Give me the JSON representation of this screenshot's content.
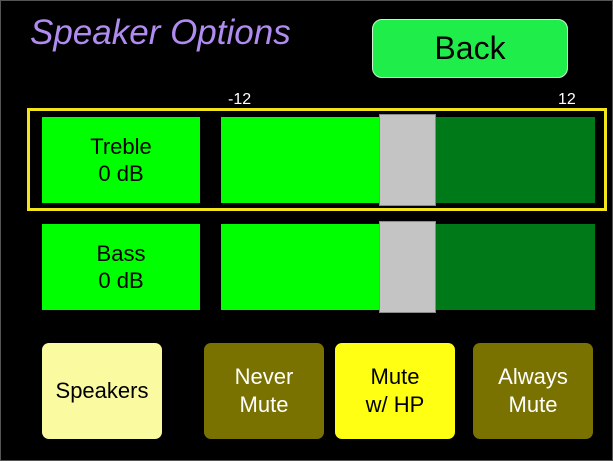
{
  "screen": {
    "title": "Speaker Options",
    "back_label": "Back"
  },
  "scale": {
    "min_label": "-12",
    "max_label": "12",
    "min": -12,
    "max": 12
  },
  "controls": [
    {
      "name": "Treble",
      "value_text": "0 dB",
      "value": 0,
      "selected": true
    },
    {
      "name": "Bass",
      "value_text": "0 dB",
      "value": 0,
      "selected": false
    }
  ],
  "modes": [
    {
      "lines": [
        "Speakers"
      ],
      "color": "#fafaa0",
      "text_color": "#000000"
    },
    {
      "lines": [
        "Never",
        "Mute"
      ],
      "color": "#7a7200",
      "text_color": "#ffffff"
    },
    {
      "lines": [
        "Mute",
        "w/ HP"
      ],
      "color": "#ffff14",
      "text_color": "#000000"
    },
    {
      "lines": [
        "Always",
        "Mute"
      ],
      "color": "#7a7200",
      "text_color": "#ffffff"
    }
  ],
  "colors": {
    "background": "#000000",
    "title": "#b08cf0",
    "back_button": "#1fee4a",
    "selection_outline": "#f3e51b",
    "slider_fill": "#00ff00",
    "slider_track": "#007a18",
    "slider_thumb": "#c4c4c4"
  }
}
